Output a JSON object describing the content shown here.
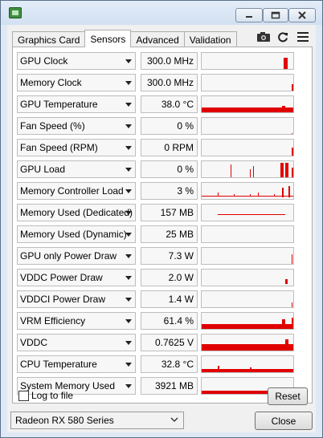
{
  "window": {
    "title": "",
    "controls": {
      "minimize": "min-icon",
      "maximize": "max-icon",
      "close": "close-icon"
    }
  },
  "tabs": [
    {
      "label": "Graphics Card",
      "active": false
    },
    {
      "label": "Sensors",
      "active": true
    },
    {
      "label": "Advanced",
      "active": false
    },
    {
      "label": "Validation",
      "active": false
    }
  ],
  "toolbar": {
    "camera_icon": "camera-icon",
    "refresh_icon": "refresh-icon",
    "menu_icon": "hamburger-menu-icon"
  },
  "sensors": [
    {
      "name": "GPU Clock",
      "value": "300.0 MHz"
    },
    {
      "name": "Memory Clock",
      "value": "300.0 MHz"
    },
    {
      "name": "GPU Temperature",
      "value": "38.0 °C"
    },
    {
      "name": "Fan Speed (%)",
      "value": "0 %"
    },
    {
      "name": "Fan Speed (RPM)",
      "value": "0 RPM"
    },
    {
      "name": "GPU Load",
      "value": "0 %"
    },
    {
      "name": "Memory Controller Load",
      "value": "3 %"
    },
    {
      "name": "Memory Used (Dedicated)",
      "value": "157 MB"
    },
    {
      "name": "Memory Used (Dynamic)",
      "value": "25 MB"
    },
    {
      "name": "GPU only Power Draw",
      "value": "7.3 W"
    },
    {
      "name": "VDDC Power Draw",
      "value": "2.0 W"
    },
    {
      "name": "VDDCI Power Draw",
      "value": "1.4 W"
    },
    {
      "name": "VRM Efficiency",
      "value": "61.4 %"
    },
    {
      "name": "VDDC",
      "value": "0.7625 V"
    },
    {
      "name": "CPU Temperature",
      "value": "32.8 °C"
    },
    {
      "name": "System Memory Used",
      "value": "3921 MB"
    }
  ],
  "footer": {
    "log_label": "Log to file",
    "log_checked": false,
    "reset_label": "Reset"
  },
  "bottom": {
    "gpu_selected": "Radeon RX 580 Series",
    "close_label": "Close"
  },
  "colors": {
    "graph": "#e00000",
    "window_frame": "#dfe9f5"
  }
}
